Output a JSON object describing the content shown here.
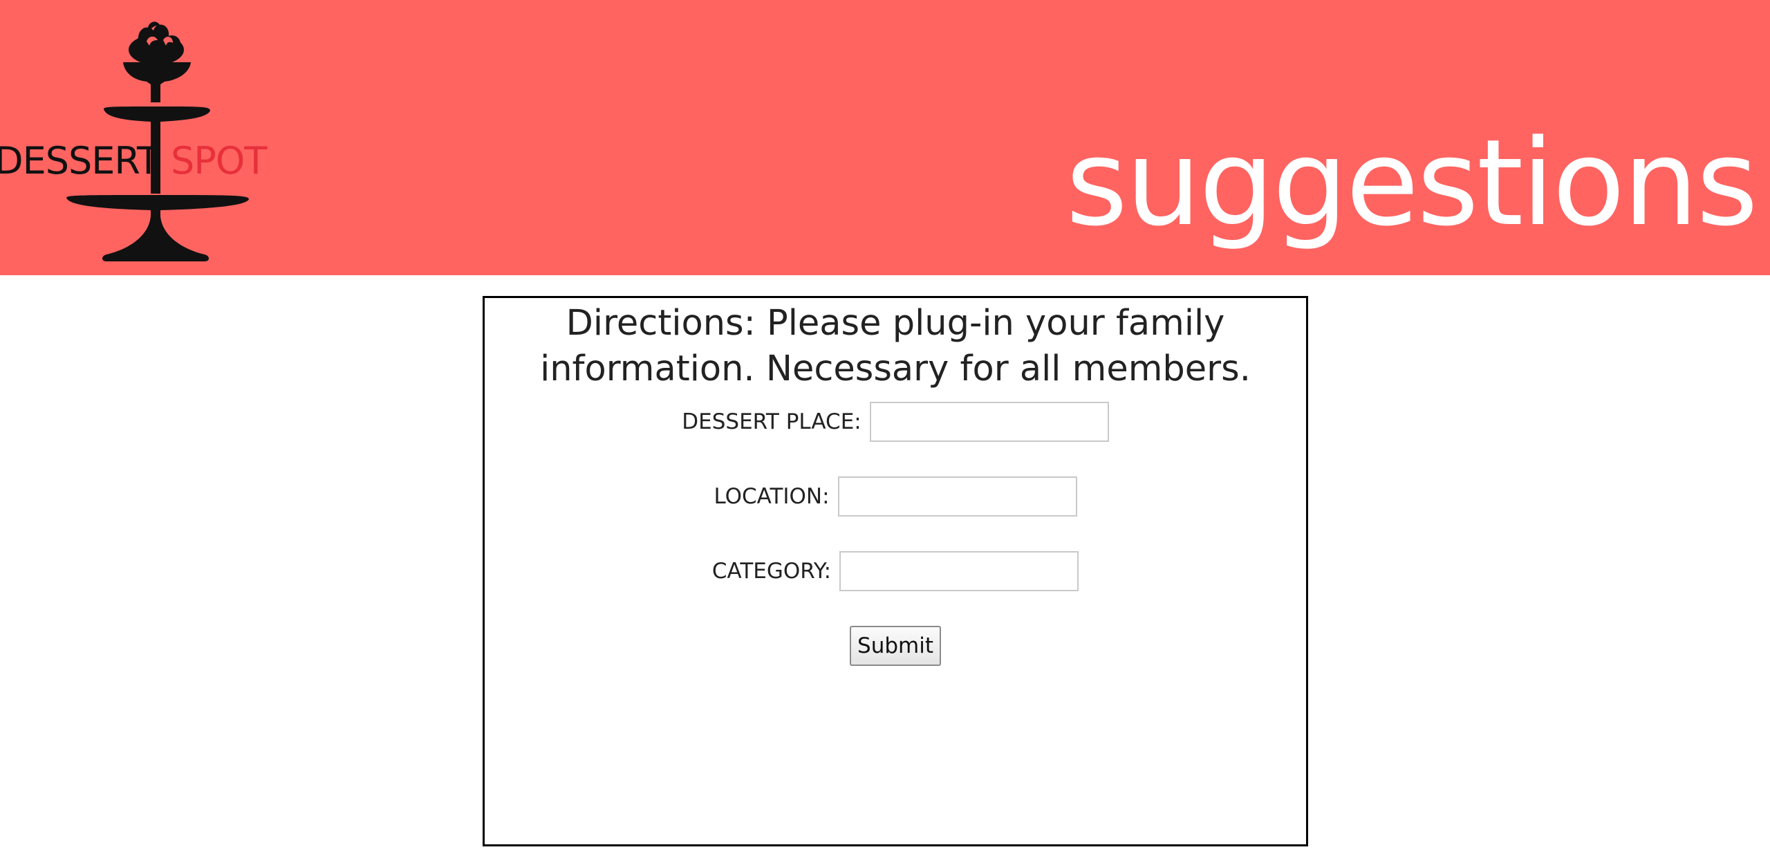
{
  "header": {
    "logo": {
      "word_1": "DESSERT",
      "word_2": "SPOT"
    },
    "title": "suggestions"
  },
  "form": {
    "directions": "Directions: Please plug-in your family information. Necessary for all members.",
    "fields": [
      {
        "label": "DESSERT PLACE:",
        "value": "",
        "placeholder": ""
      },
      {
        "label": "LOCATION:",
        "value": "",
        "placeholder": ""
      },
      {
        "label": "CATEGORY:",
        "value": "",
        "placeholder": ""
      }
    ],
    "submit_label": "Submit"
  },
  "colors": {
    "header_background": "#ff6461",
    "logo_accent": "#e8303a",
    "title_text": "#ffffff",
    "form_border": "#000000"
  },
  "icons": {
    "logo_graphic": "dessert-stand-icon"
  }
}
